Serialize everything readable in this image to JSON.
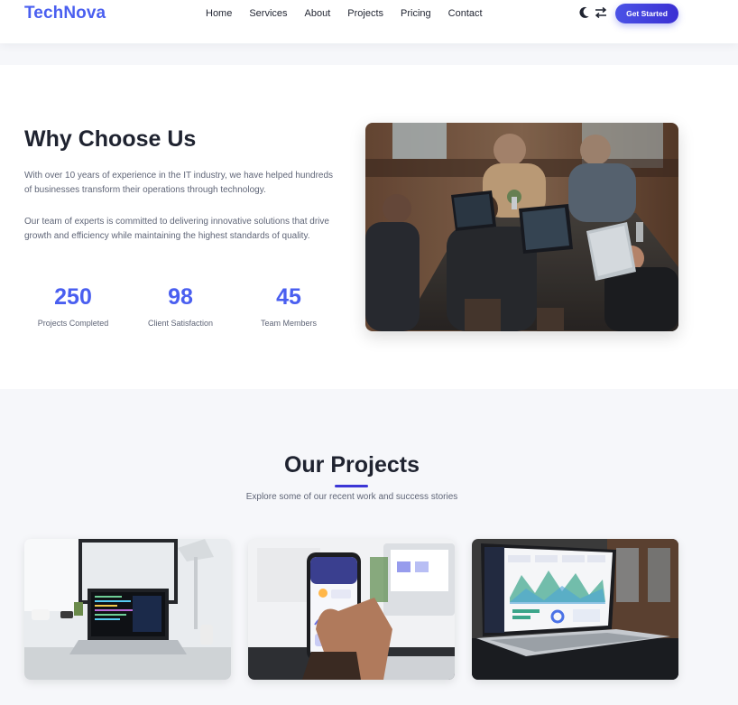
{
  "header": {
    "logo": "TechNova",
    "nav": [
      "Home",
      "Services",
      "About",
      "Projects",
      "Pricing",
      "Contact"
    ],
    "theme_icon": "moon-icon",
    "swap_icon": "arrows-swap-icon",
    "cta_label": "Get Started"
  },
  "why": {
    "title": "Why Choose Us",
    "paragraph1": "With over 10 years of experience in the IT industry, we have helped hundreds of businesses transform their operations through technology.",
    "paragraph2": "Our team of experts is committed to delivering innovative solutions that drive growth and efficiency while maintaining the highest standards of quality.",
    "stats": [
      {
        "value": "250",
        "label": "Projects Completed"
      },
      {
        "value": "98",
        "label": "Client Satisfaction"
      },
      {
        "value": "45",
        "label": "Team Members"
      }
    ]
  },
  "projects": {
    "title": "Our Projects",
    "subtitle": "Explore some of our recent work and success stories"
  },
  "colors": {
    "accent": "#4a5ff0",
    "button": "#3a2fd3",
    "section_bg": "#f6f7fa"
  }
}
